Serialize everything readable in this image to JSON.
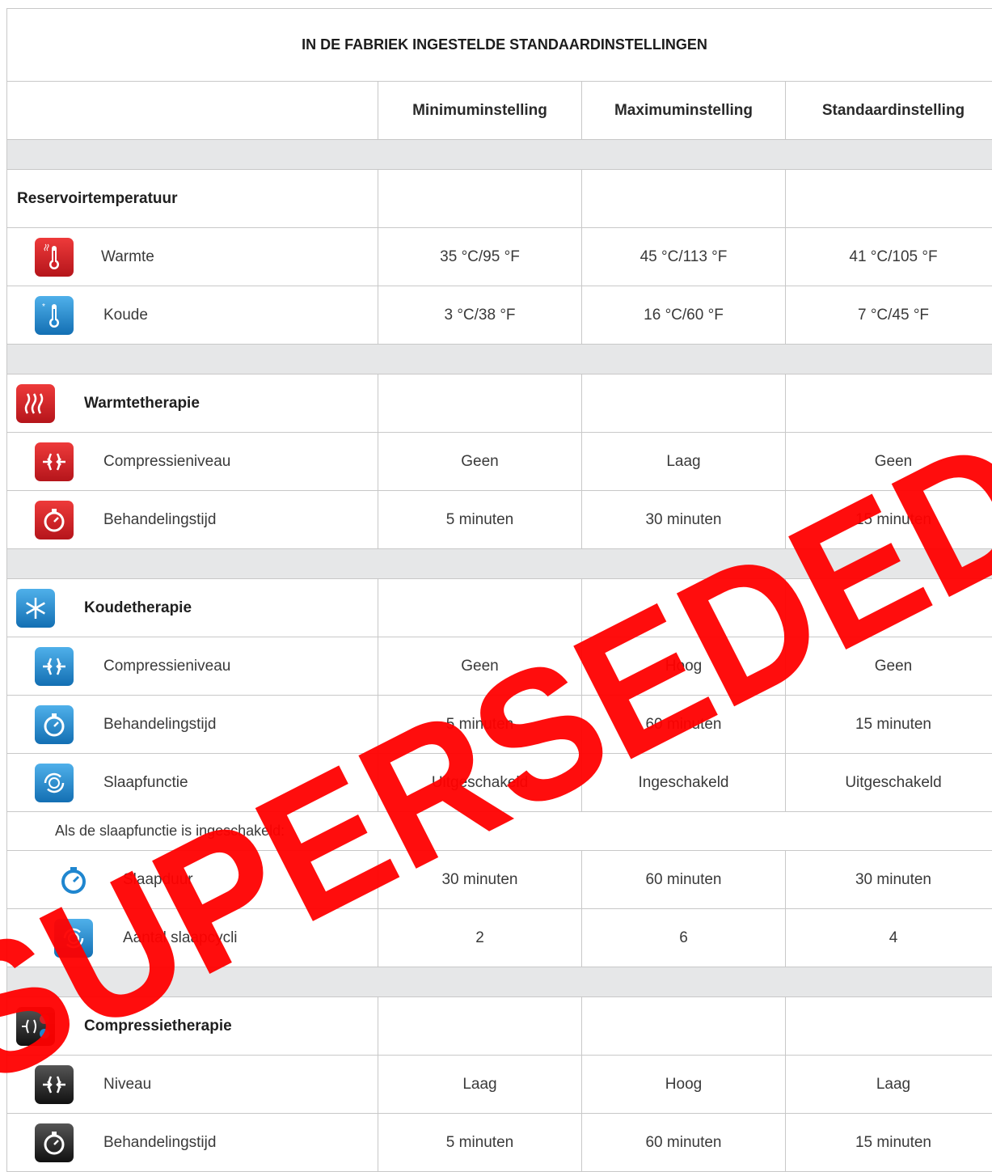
{
  "title": "IN DE FABRIEK INGESTELDE STANDAARDINSTELLINGEN",
  "headers": [
    "",
    "Minimuminstelling",
    "Maximuminstelling",
    "Standaardinstelling"
  ],
  "reservoir": {
    "label": "Reservoirtemperatuur",
    "rows": [
      {
        "label": "Warmte",
        "icon": "heat-thermometer-icon",
        "values": [
          "35 °C/95 °F",
          "45 °C/113 °F",
          "41 °C/105 °F"
        ]
      },
      {
        "label": "Koude",
        "icon": "cold-thermometer-icon",
        "values": [
          "3 °C/38 °F",
          "16 °C/60 °F",
          "7 °C/45 °F"
        ]
      }
    ]
  },
  "heat": {
    "label": "Warmtetherapie",
    "icon": "heat-waves-icon",
    "rows": [
      {
        "label": "Compressieniveau",
        "icon": "heat-compression-icon",
        "values": [
          "Geen",
          "Laag",
          "Geen"
        ]
      },
      {
        "label": "Behandelingstijd",
        "icon": "heat-timer-icon",
        "values": [
          "5 minuten",
          "30 minuten",
          "15 minuten"
        ]
      }
    ]
  },
  "cold": {
    "label": "Koudetherapie",
    "icon": "snowflake-icon",
    "rows": [
      {
        "label": "Compressieniveau",
        "icon": "cold-compression-icon",
        "values": [
          "Geen",
          "Hoog",
          "Geen"
        ]
      },
      {
        "label": "Behandelingstijd",
        "icon": "cold-timer-icon",
        "values": [
          "5 minuten",
          "60 minuten",
          "15 minuten"
        ]
      },
      {
        "label": "Slaapfunctie",
        "icon": "sleep-cycle-icon",
        "values": [
          "Uitgeschakeld",
          "Ingeschakeld",
          "Uitgeschakeld"
        ]
      }
    ],
    "note": "Als de slaapfunctie is ingeschakeld:",
    "sub_rows": [
      {
        "label": "Slaapduur",
        "icon": "sleep-timer-icon",
        "values": [
          "30 minuten",
          "60 minuten",
          "30 minuten"
        ]
      },
      {
        "label": "Aantal slaapcycli",
        "icon": "sleep-cycles-icon",
        "values": [
          "2",
          "6",
          "4"
        ]
      }
    ]
  },
  "compression": {
    "label": "Compressietherapie",
    "icon": "compression-therapy-icon",
    "rows": [
      {
        "label": "Niveau",
        "icon": "compression-level-icon",
        "values": [
          "Laag",
          "Hoog",
          "Laag"
        ]
      },
      {
        "label": "Behandelingstijd",
        "icon": "compression-timer-icon",
        "values": [
          "5 minuten",
          "60 minuten",
          "15 minuten"
        ]
      }
    ]
  },
  "watermark": {
    "text": "SUPERSEDED",
    "color": "#ff0000"
  },
  "colors": {
    "red_icon": "#d32027",
    "blue_icon": "#1f86cf",
    "dark_icon": "#222222",
    "separator": "#e6e7e8",
    "border": "#c8c8c8"
  }
}
